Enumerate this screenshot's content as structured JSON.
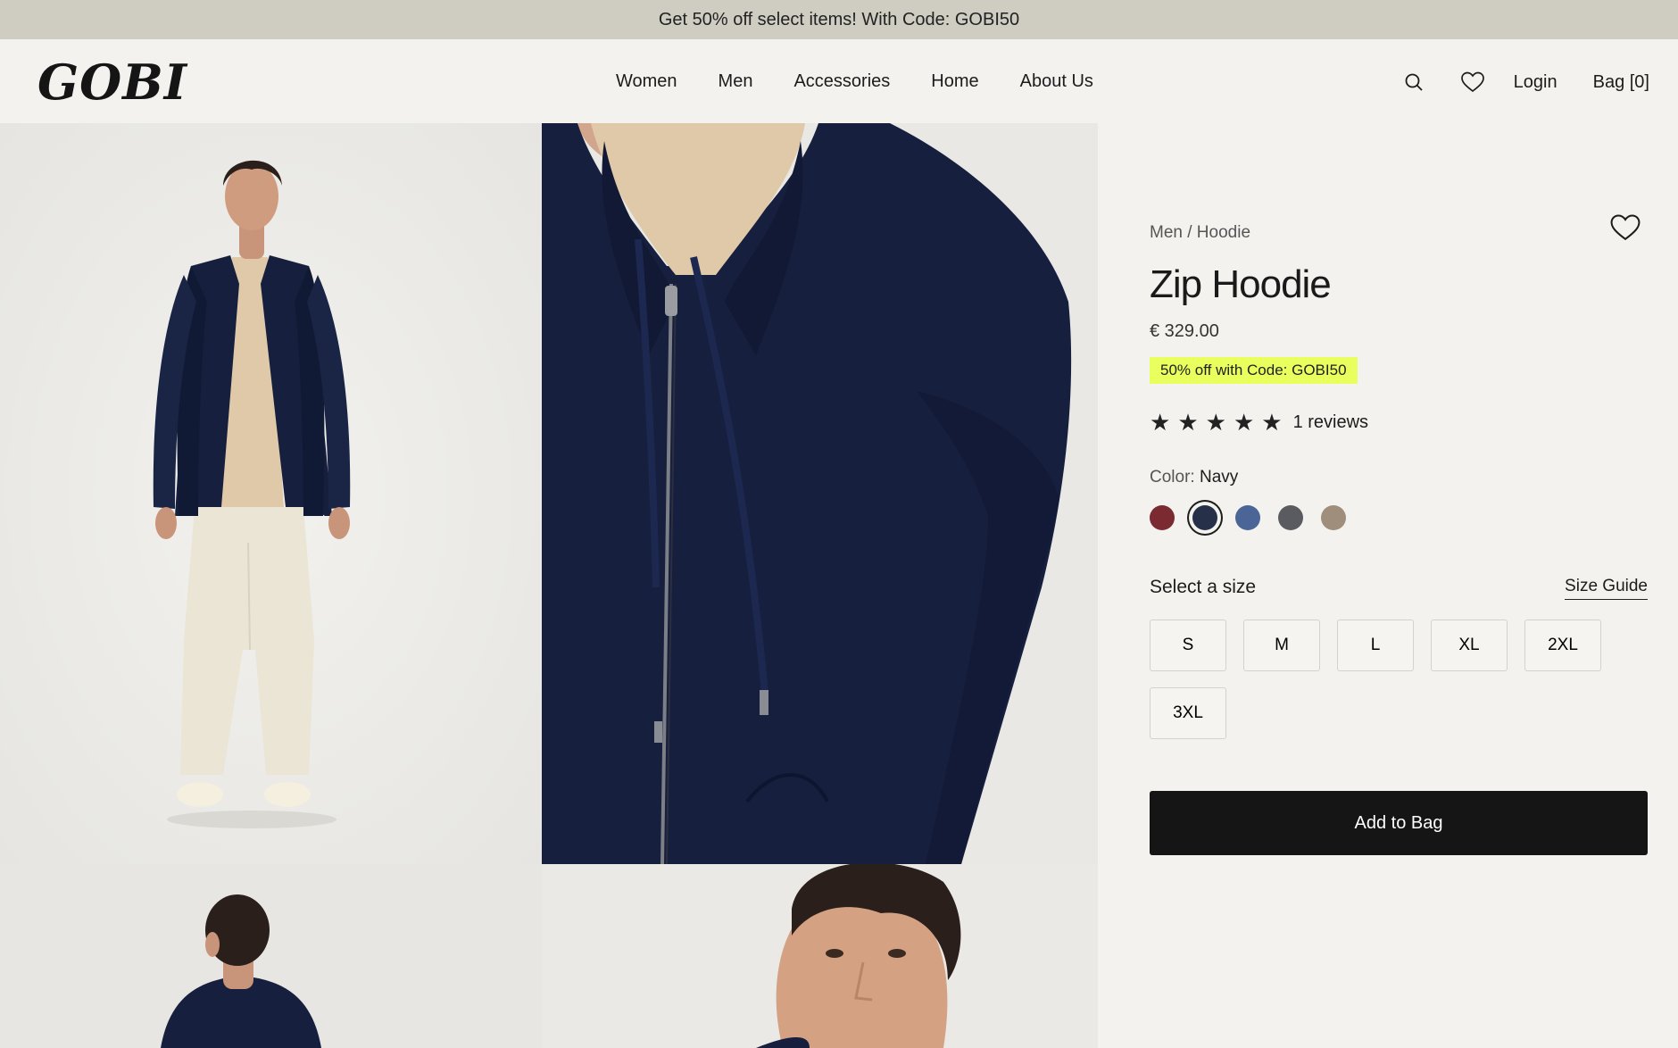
{
  "promo": {
    "text": "Get 50% off select items! With Code: GOBI50"
  },
  "header": {
    "logo": "GOBI",
    "nav": [
      "Women",
      "Men",
      "Accessories",
      "Home",
      "About Us"
    ],
    "login_label": "Login",
    "bag_label": "Bag [0]",
    "icons": [
      "search-icon",
      "heart-icon"
    ]
  },
  "product": {
    "breadcrumb": "Men / Hoodie",
    "title": "Zip Hoodie",
    "price": "€ 329.00",
    "promo_badge": "50% off with Code: GOBI50",
    "rating": 5,
    "reviews_label": "1 reviews",
    "color_label": "Color:",
    "color_value": "Navy",
    "swatches": [
      {
        "color": "#7a2a30",
        "selected": false
      },
      {
        "color": "#263149",
        "selected": true
      },
      {
        "color": "#4a6596",
        "selected": false
      },
      {
        "color": "#5a5b60",
        "selected": false
      },
      {
        "color": "#9e8e7b",
        "selected": false
      }
    ],
    "size_heading": "Select a size",
    "size_guide_label": "Size Guide",
    "sizes": [
      "S",
      "M",
      "L",
      "XL",
      "2XL",
      "3XL"
    ],
    "add_to_bag_label": "Add to Bag"
  },
  "colors": {
    "promo_bar": "#cfcdc2",
    "badge": "#e8ff5e",
    "hoodie_navy": "#161f3d",
    "button": "#151515"
  }
}
